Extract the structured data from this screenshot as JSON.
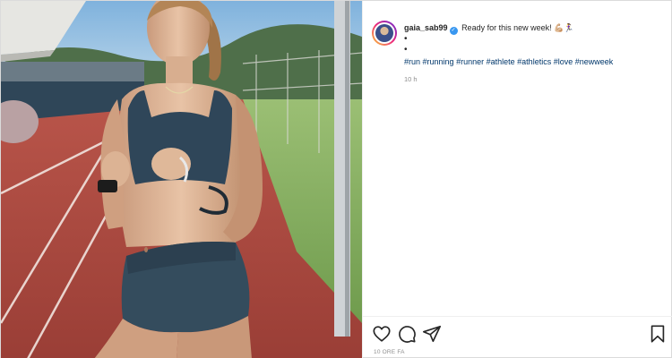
{
  "post": {
    "username": "gaia_sab99",
    "verified": true,
    "caption": "Ready for this new week!",
    "caption_emojis": "💪🏼🏃‍♀️",
    "dot_lines": [
      "•",
      "•"
    ],
    "hashtags": [
      "#run",
      "#running",
      "#runner",
      "#athlete",
      "#athletics",
      "#love",
      "#newweek"
    ],
    "time": "10 h",
    "date": "10 ORE FA"
  },
  "icons": {
    "like": "heart-icon",
    "comment": "comment-icon",
    "share": "share-icon",
    "save": "bookmark-icon",
    "verified": "verified-badge-icon"
  },
  "colors": {
    "hashtag": "#00376b",
    "verified": "#3897f0",
    "muted": "#8e8e8e"
  }
}
